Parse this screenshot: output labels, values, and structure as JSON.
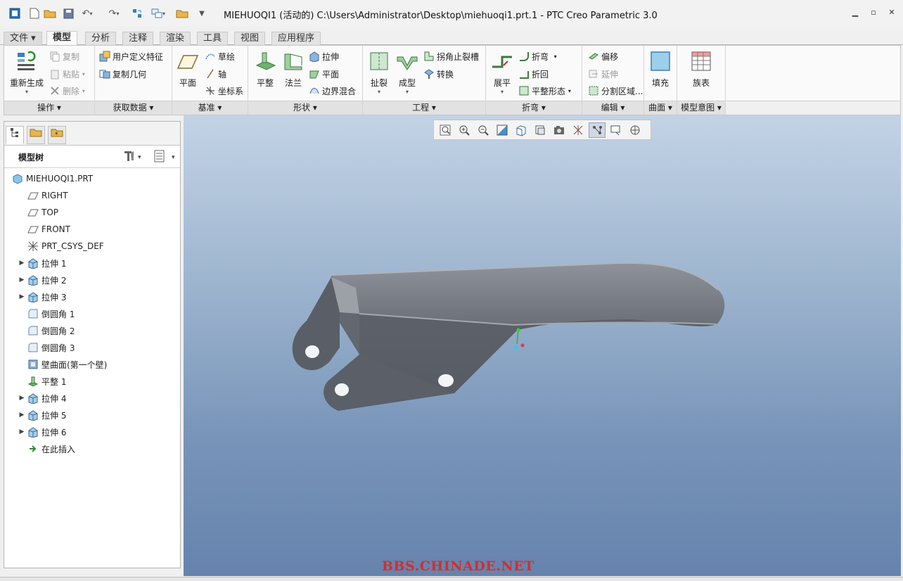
{
  "window": {
    "title": "MIEHUOQI1 (活动的) C:\\Users\\Administrator\\Desktop\\miehuoqi1.prt.1 - PTC Creo Parametric 3.0"
  },
  "tabs": [
    {
      "label": "文件 ▾"
    },
    {
      "label": "模型"
    },
    {
      "label": "分析"
    },
    {
      "label": "注释"
    },
    {
      "label": "渲染"
    },
    {
      "label": "工具"
    },
    {
      "label": "视图"
    },
    {
      "label": "应用程序"
    }
  ],
  "ribbon": {
    "ops": {
      "regen": "重新生成",
      "copy": "复制",
      "paste": "粘贴",
      "delete": "删除",
      "footer": "操作 ▾"
    },
    "getdata": {
      "udf": "用户定义特征",
      "copygeom": "复制几何",
      "footer": "获取数据 ▾"
    },
    "datum": {
      "plane": "平面",
      "sketch": "草绘",
      "axis": "轴",
      "csys": "坐标系",
      "footer": "基准 ▾"
    },
    "shape": {
      "flat": "平整",
      "flange": "法兰",
      "extrude": "拉伸",
      "planar": "平面",
      "blend": "边界混合",
      "footer": "形状 ▾"
    },
    "engineering": {
      "rip": "扯裂",
      "form": "成型",
      "cornerrelief": "拐角止裂槽",
      "convert": "转换",
      "footer": "工程 ▾"
    },
    "bend": {
      "unbend": "展平",
      "bend": "折弯",
      "bendback": "折回",
      "flatpattern": "平整形态",
      "footer": "折弯 ▾"
    },
    "edit": {
      "offset": "偏移",
      "extend": "延伸",
      "split": "分割区域...",
      "footer": "编辑 ▾"
    },
    "surface": {
      "fill": "填充",
      "footer": "曲面 ▾"
    },
    "intent": {
      "family": "族表",
      "footer": "模型意图 ▾"
    }
  },
  "model_tree": {
    "title": "模型树",
    "items": [
      {
        "label": "MIEHUOQI1.PRT",
        "expand": ""
      },
      {
        "label": "RIGHT",
        "expand": ""
      },
      {
        "label": "TOP",
        "expand": ""
      },
      {
        "label": "FRONT",
        "expand": ""
      },
      {
        "label": "PRT_CSYS_DEF",
        "expand": ""
      },
      {
        "label": "拉伸 1",
        "expand": "▶"
      },
      {
        "label": "拉伸 2",
        "expand": "▶"
      },
      {
        "label": "拉伸 3",
        "expand": "▶"
      },
      {
        "label": "倒圆角 1",
        "expand": ""
      },
      {
        "label": "倒圆角 2",
        "expand": ""
      },
      {
        "label": "倒圆角 3",
        "expand": ""
      },
      {
        "label": "壁曲面(第一个壁)",
        "expand": ""
      },
      {
        "label": "平整 1",
        "expand": ""
      },
      {
        "label": "拉伸 4",
        "expand": "▶"
      },
      {
        "label": "拉伸 5",
        "expand": "▶"
      },
      {
        "label": "拉伸 6",
        "expand": "▶"
      },
      {
        "label": "在此插入",
        "expand": ""
      }
    ]
  },
  "viewport": {
    "watermark": "BBS.CHINADE.NET"
  },
  "colors": {
    "accent": "#3a7fc0",
    "part": "#5f636b",
    "watermark": "#d82c2c"
  }
}
